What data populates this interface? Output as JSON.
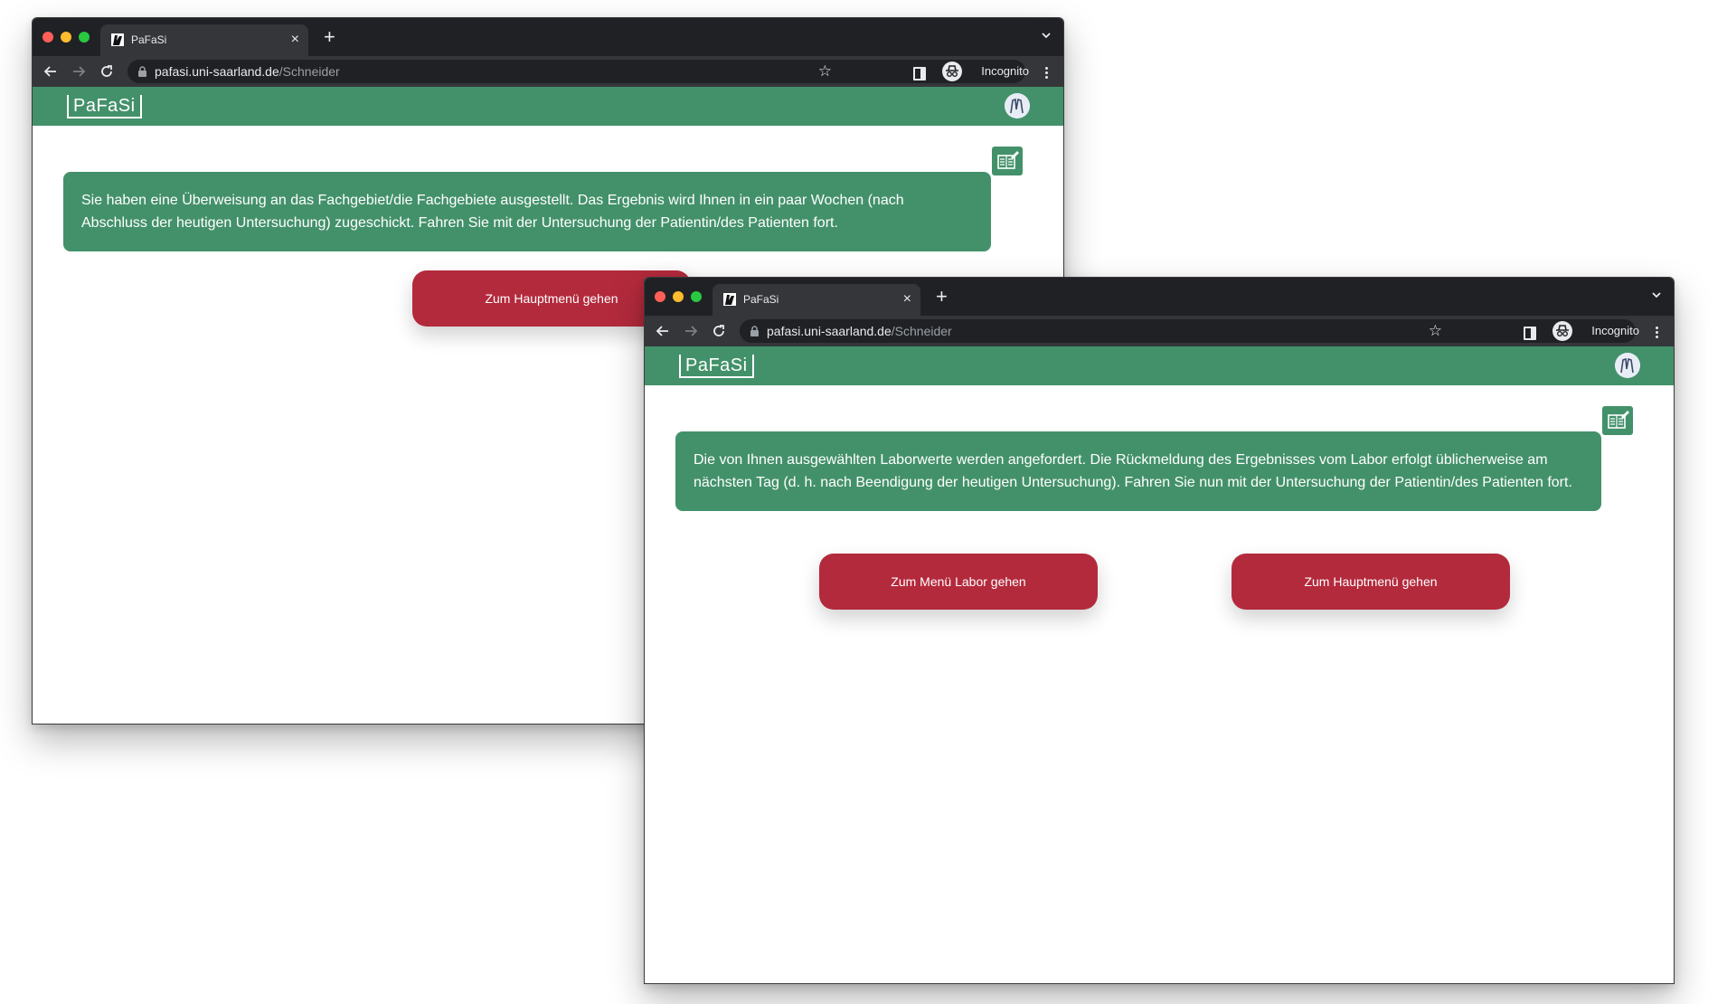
{
  "windows": [
    {
      "tab_title": "PaFaSi",
      "url_host": "pafasi.uni-saarland.de",
      "url_path": "/Schneider",
      "incognito_label": "Incognito",
      "logo": "PaFaSi",
      "message": "Sie haben eine Überweisung an das Fachgebiet/die Fachgebiete ausgestellt. Das Ergebnis wird Ihnen in ein paar Wochen (nach Abschluss der heutigen Untersuchung) zugeschickt. Fahren Sie mit der Untersuchung der Patientin/des Patienten fort.",
      "buttons": {
        "main_menu": "Zum Hauptmenü gehen"
      }
    },
    {
      "tab_title": "PaFaSi",
      "url_host": "pafasi.uni-saarland.de",
      "url_path": "/Schneider",
      "incognito_label": "Incognito",
      "logo": "PaFaSi",
      "message": "Die von Ihnen ausgewählten Laborwerte werden angefordert. Die Rückmeldung des Ergebnisses vom Labor erfolgt üblicherweise am nächsten Tag (d. h. nach Beendigung der heutigen Untersuchung). Fahren Sie nun mit der Untersuchung der Patientin/des Patienten fort.",
      "buttons": {
        "lab_menu": "Zum Menü Labor gehen",
        "main_menu": "Zum Hauptmenü gehen"
      }
    }
  ],
  "icons": {
    "favicon": "pafasi-favicon-icon",
    "notes": "notes-edit-icon",
    "user": "user-avatar-icon",
    "incognito": "incognito-icon"
  },
  "colors": {
    "accent_green": "#43916a",
    "button_red": "#b32a3c",
    "chrome_dark": "#202124",
    "chrome_toolbar": "#35363a"
  }
}
